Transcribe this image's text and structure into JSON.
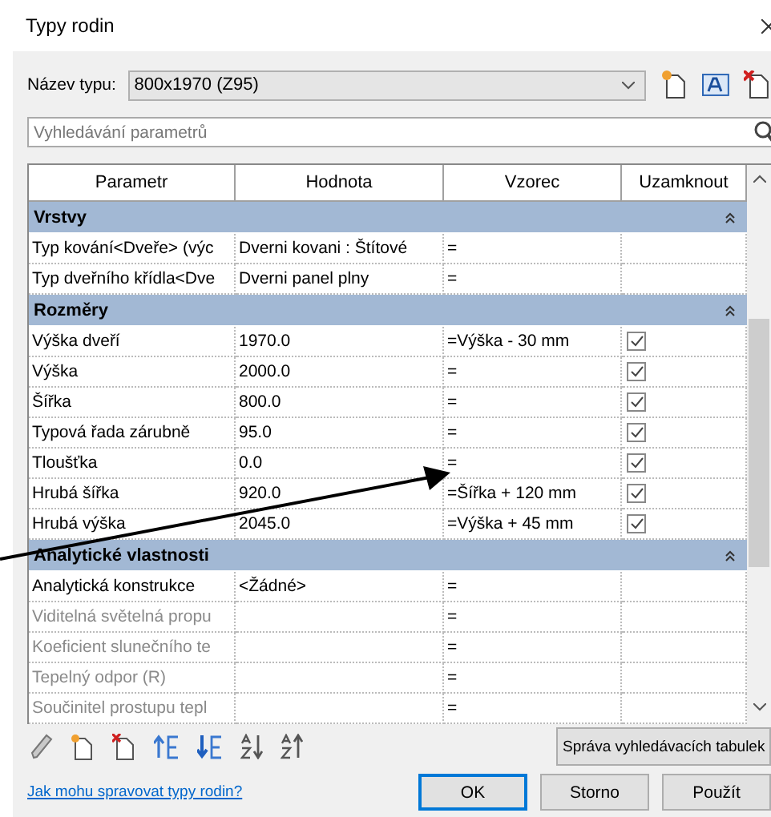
{
  "window": {
    "title": "Typy rodin"
  },
  "type_name": {
    "label": "Název typu:",
    "value": "800x1970 (Z95)"
  },
  "search": {
    "placeholder": "Vyhledávání parametrů"
  },
  "table": {
    "columns": [
      "Parametr",
      "Hodnota",
      "Vzorec",
      "Uzamknout"
    ],
    "rows": [
      {
        "kind": "group",
        "name": "Vrstvy"
      },
      {
        "kind": "param",
        "name": "Typ kování<Dveře> (výc",
        "value": "Dverni kovani : Štítové",
        "formula": "=",
        "disabled": false
      },
      {
        "kind": "param",
        "name": "Typ dveřního křídla<Dve",
        "value": "Dverni panel plny",
        "formula": "=",
        "disabled": false
      },
      {
        "kind": "group",
        "name": "Rozměry"
      },
      {
        "kind": "param",
        "name": "Výška dveří",
        "value": "1970.0",
        "formula": "=Výška - 30 mm",
        "disabled": false,
        "locked": true
      },
      {
        "kind": "param",
        "name": "Výška",
        "value": "2000.0",
        "formula": "=",
        "disabled": false,
        "locked": true
      },
      {
        "kind": "param",
        "name": "Šířka",
        "value": "800.0",
        "formula": "=",
        "disabled": false,
        "locked": true
      },
      {
        "kind": "param",
        "name": "Typová řada zárubně",
        "value": "95.0",
        "formula": "=",
        "disabled": false,
        "locked": true
      },
      {
        "kind": "param",
        "name": "Tloušťka",
        "value": "0.0",
        "formula": "=",
        "disabled": false,
        "locked": true
      },
      {
        "kind": "param",
        "name": "Hrubá šířka",
        "value": "920.0",
        "formula": "=Šířka + 120 mm",
        "disabled": false,
        "locked": true
      },
      {
        "kind": "param",
        "name": "Hrubá výška",
        "value": "2045.0",
        "formula": "=Výška + 45 mm",
        "disabled": false,
        "locked": true
      },
      {
        "kind": "group",
        "name": "Analytické vlastnosti"
      },
      {
        "kind": "param",
        "name": "Analytická konstrukce",
        "value": "<Žádné>",
        "formula": "=",
        "disabled": false
      },
      {
        "kind": "param",
        "name": "Viditelná světelná propu",
        "formula": "=",
        "disabled": true
      },
      {
        "kind": "param",
        "name": "Koeficient slunečního te",
        "formula": "=",
        "disabled": true
      },
      {
        "kind": "param",
        "name": "Tepelný odpor (R)",
        "formula": "=",
        "disabled": true
      },
      {
        "kind": "param",
        "name": "Součinitel prostupu tepl",
        "formula": "=",
        "disabled": true
      }
    ]
  },
  "lookup_button": "Správa vyhledávacích tabulek",
  "help_link": "Jak mohu spravovat typy rodin?",
  "buttons": [
    {
      "label": "OK",
      "selected": true
    },
    {
      "label": "Storno",
      "selected": false
    },
    {
      "label": "Použít",
      "selected": false
    }
  ]
}
